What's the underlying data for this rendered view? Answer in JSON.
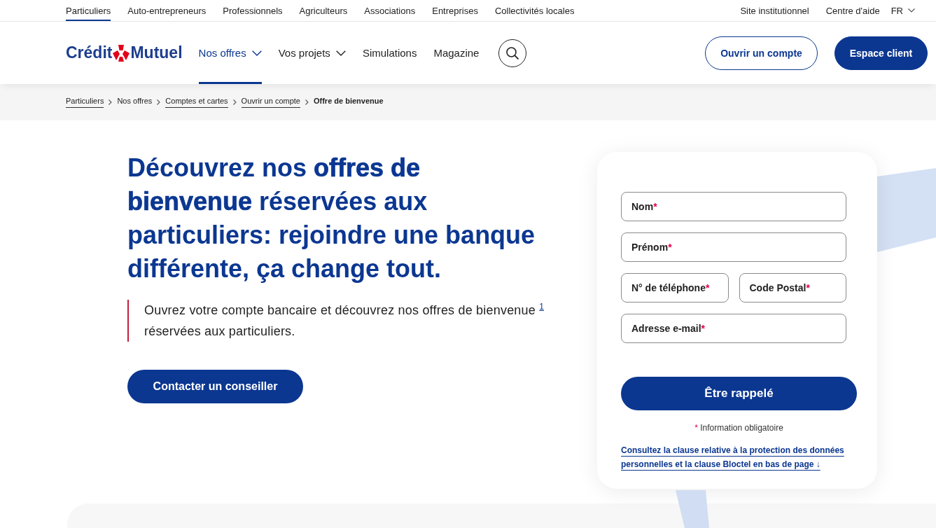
{
  "top_bar": {
    "segments": [
      {
        "label": "Particuliers",
        "selected": true
      },
      {
        "label": "Auto-entrepreneurs",
        "selected": false
      },
      {
        "label": "Professionnels",
        "selected": false
      },
      {
        "label": "Agriculteurs",
        "selected": false
      },
      {
        "label": "Associations",
        "selected": false
      },
      {
        "label": "Entreprises",
        "selected": false
      },
      {
        "label": "Collectivités locales",
        "selected": false
      }
    ],
    "links": [
      "Site institutionnel",
      "Centre d'aide"
    ],
    "language": "FR"
  },
  "header": {
    "logo": {
      "left": "Crédit",
      "right": "Mutuel"
    },
    "nav": [
      {
        "label": "Nos offres",
        "selected": true,
        "dropdown": true
      },
      {
        "label": "Vos projets",
        "selected": false,
        "dropdown": true
      },
      {
        "label": "Simulations",
        "selected": false,
        "dropdown": false
      },
      {
        "label": "Magazine",
        "selected": false,
        "dropdown": false
      }
    ],
    "actions": [
      {
        "label": "Ouvrir un compte",
        "kind": "outline"
      },
      {
        "label": "Espace client",
        "kind": "filled"
      }
    ]
  },
  "breadcrumb": [
    {
      "label": "Particuliers",
      "link": true,
      "current": false
    },
    {
      "label": "Nos offres",
      "link": false,
      "current": false
    },
    {
      "label": "Comptes et cartes",
      "link": true,
      "current": false
    },
    {
      "label": "Ouvrir un compte",
      "link": true,
      "current": false
    },
    {
      "label": "Offre de bienvenue",
      "link": false,
      "current": true
    }
  ],
  "hero": {
    "title": "Découvrez nos **offres de bienvenue** réservées aux particuliers: rejoindre une banque différente, ça change tout.",
    "intro": {
      "text": "Ouvrez votre compte bancaire et découvrez nos offres de bienvenue",
      "footnote": "1",
      "text_end": "réservées aux particuliers."
    },
    "cta": "Contacter un conseiller"
  },
  "callback_form": {
    "rows": [
      {
        "fields": [
          {
            "placeholder": "Nom",
            "mark": "*"
          }
        ]
      },
      {
        "fields": [
          {
            "placeholder": "Prénom",
            "mark": "*"
          }
        ]
      },
      {
        "fields": [
          {
            "placeholder": "N° de téléphone",
            "mark": "*"
          },
          {
            "placeholder": "Code Postal",
            "mark": "*"
          }
        ]
      },
      {
        "fields": [
          {
            "placeholder": "Adresse e-mail",
            "mark": "*"
          }
        ]
      }
    ],
    "submit": "Être rappelé",
    "legend": {
      "mark": "*",
      "text": "Information obligatoire"
    },
    "privacy_link": "Consultez la clause relative à la protection des données personnelles et la clause Bloctel en bas de page ↓"
  }
}
